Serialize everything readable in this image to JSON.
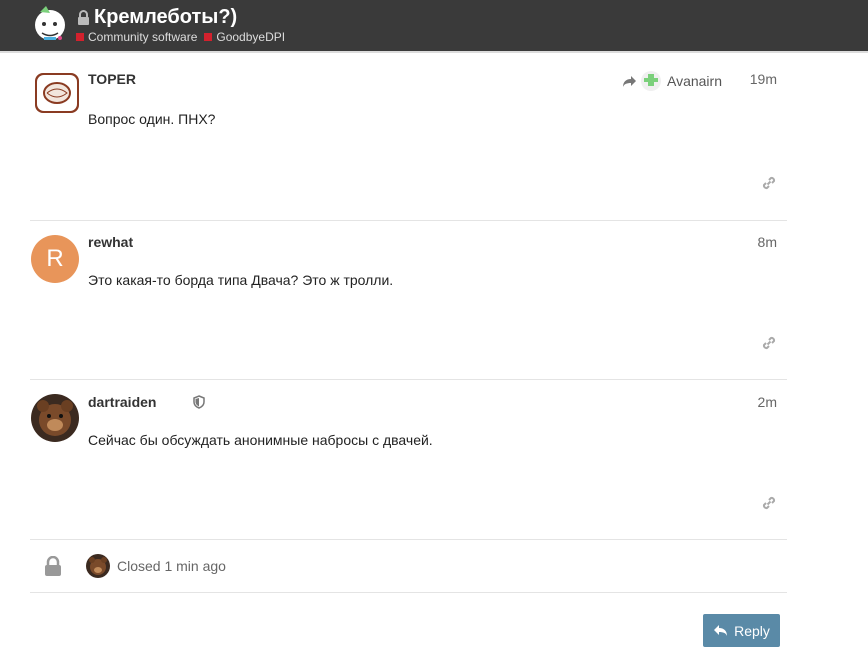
{
  "header": {
    "title": "Кремлеботы?)",
    "categories": [
      {
        "label": "Community software",
        "color": "#d3212d"
      },
      {
        "label": "GoodbyeDPI",
        "color": "#d3212d"
      }
    ]
  },
  "posts": [
    {
      "username": "TOPER",
      "date": "19m",
      "body": "Вопрос один. ПНХ?",
      "reply_to": "Avanairn"
    },
    {
      "username": "rewhat",
      "date": "8m",
      "body": "Это какая-то борда типа Двача? Это ж тролли.",
      "avatar_letter": "R",
      "avatar_color": "#e8955a"
    },
    {
      "username": "dartraiden",
      "date": "2m",
      "body": "Сейчас бы обсуждать анонимные наброcы с двачей."
    }
  ],
  "closed": {
    "text": "Closed 1 min ago"
  },
  "reply_button": {
    "label": "Reply",
    "color": "#5a8aa7"
  }
}
